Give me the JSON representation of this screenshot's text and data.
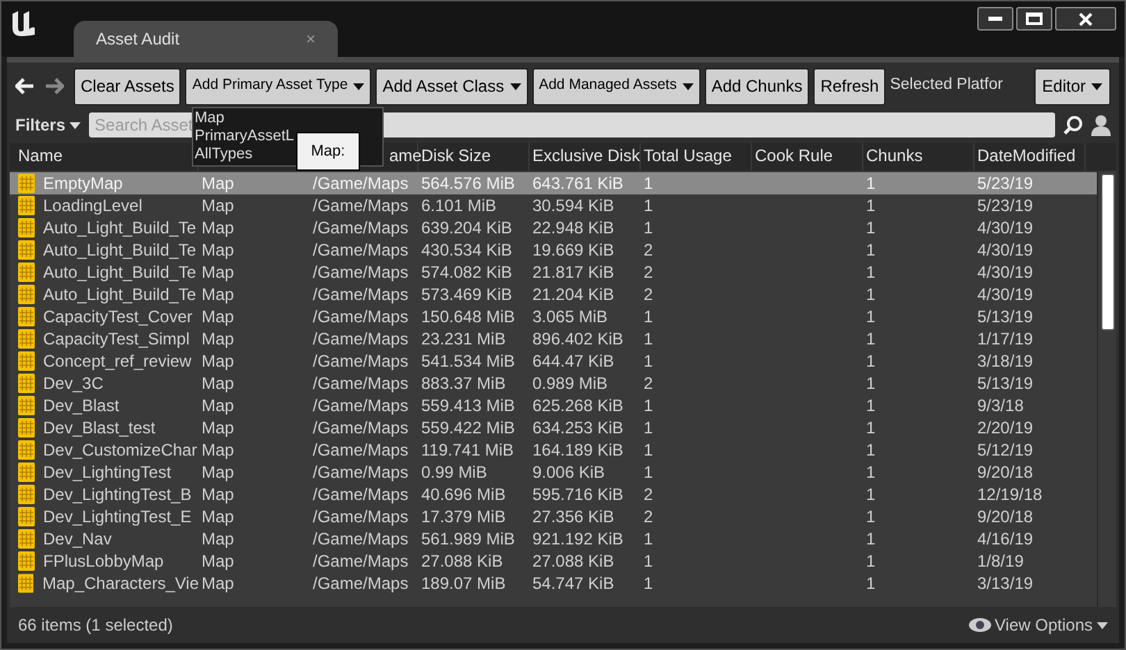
{
  "window": {
    "tab": {
      "title": "Asset Audit",
      "close": "×"
    }
  },
  "toolbar": {
    "buttons": [
      {
        "label": "Clear Assets",
        "dropdown": false,
        "small": false
      },
      {
        "label": "Add Primary Asset Type",
        "dropdown": true,
        "small": true
      },
      {
        "label": "Add Asset Class",
        "dropdown": true,
        "small": false
      },
      {
        "label": "Add Managed Assets",
        "dropdown": true,
        "small": true
      },
      {
        "label": "Add Chunks",
        "dropdown": false,
        "small": false
      },
      {
        "label": "Refresh",
        "dropdown": false,
        "small": false
      }
    ],
    "platform_label": "Selected Platfor",
    "platform": "Editor"
  },
  "dropdown_menu": {
    "items": [
      "Map",
      "PrimaryAssetL",
      "AllTypes"
    ]
  },
  "tooltip": "Map:",
  "filters": {
    "label": "Filters",
    "search_placeholder": "Search Asset"
  },
  "table": {
    "columns": [
      {
        "label": "Name"
      },
      {},
      {
        "label": "ame"
      },
      {
        "label": "Disk Size"
      },
      {
        "label": "Exclusive Disk"
      },
      {
        "label": "Total Usage"
      },
      {
        "label": "Cook Rule"
      },
      {
        "label": "Chunks"
      },
      {
        "label": "DateModified"
      }
    ],
    "rows": [
      {
        "name": "EmptyMap",
        "type": "Map",
        "path": "/Game/Maps",
        "disk_size": "564.576 MiB",
        "exclusive_disk": "643.761 KiB",
        "total_usage": "1",
        "chunks": "1",
        "date_modified": "5/23/19",
        "selected": true
      },
      {
        "name": "LoadingLevel",
        "type": "Map",
        "path": "/Game/Maps",
        "disk_size": "6.101 MiB",
        "exclusive_disk": "30.594 KiB",
        "total_usage": "1",
        "chunks": "1",
        "date_modified": "5/23/19",
        "selected": false
      },
      {
        "name": "Auto_Light_Build_Te",
        "type": "Map",
        "path": "/Game/Maps",
        "disk_size": "639.204 KiB",
        "exclusive_disk": "22.948 KiB",
        "total_usage": "1",
        "chunks": "1",
        "date_modified": "4/30/19",
        "selected": false
      },
      {
        "name": "Auto_Light_Build_Te",
        "type": "Map",
        "path": "/Game/Maps",
        "disk_size": "430.534 KiB",
        "exclusive_disk": "19.669 KiB",
        "total_usage": "2",
        "chunks": "1",
        "date_modified": "4/30/19",
        "selected": false
      },
      {
        "name": "Auto_Light_Build_Te",
        "type": "Map",
        "path": "/Game/Maps",
        "disk_size": "574.082 KiB",
        "exclusive_disk": "21.817 KiB",
        "total_usage": "2",
        "chunks": "1",
        "date_modified": "4/30/19",
        "selected": false
      },
      {
        "name": "Auto_Light_Build_Te",
        "type": "Map",
        "path": "/Game/Maps",
        "disk_size": "573.469 KiB",
        "exclusive_disk": "21.204 KiB",
        "total_usage": "2",
        "chunks": "1",
        "date_modified": "4/30/19",
        "selected": false
      },
      {
        "name": "CapacityTest_Cover",
        "type": "Map",
        "path": "/Game/Maps",
        "disk_size": "150.648 MiB",
        "exclusive_disk": "3.065 MiB",
        "total_usage": "1",
        "chunks": "1",
        "date_modified": "5/13/19",
        "selected": false
      },
      {
        "name": "CapacityTest_Simpl",
        "type": "Map",
        "path": "/Game/Maps",
        "disk_size": "23.231 MiB",
        "exclusive_disk": "896.402 KiB",
        "total_usage": "1",
        "chunks": "1",
        "date_modified": "1/17/19",
        "selected": false
      },
      {
        "name": "Concept_ref_review",
        "type": "Map",
        "path": "/Game/Maps",
        "disk_size": "541.534 MiB",
        "exclusive_disk": "644.47 KiB",
        "total_usage": "1",
        "chunks": "1",
        "date_modified": "3/18/19",
        "selected": false
      },
      {
        "name": "Dev_3C",
        "type": "Map",
        "path": "/Game/Maps",
        "disk_size": "883.37 MiB",
        "exclusive_disk": "0.989 MiB",
        "total_usage": "2",
        "chunks": "1",
        "date_modified": "5/13/19",
        "selected": false
      },
      {
        "name": "Dev_Blast",
        "type": "Map",
        "path": "/Game/Maps",
        "disk_size": "559.413 MiB",
        "exclusive_disk": "625.268 KiB",
        "total_usage": "1",
        "chunks": "1",
        "date_modified": "9/3/18",
        "selected": false
      },
      {
        "name": "Dev_Blast_test",
        "type": "Map",
        "path": "/Game/Maps",
        "disk_size": "559.422 MiB",
        "exclusive_disk": "634.253 KiB",
        "total_usage": "1",
        "chunks": "1",
        "date_modified": "2/20/19",
        "selected": false
      },
      {
        "name": "Dev_CustomizeChar",
        "type": "Map",
        "path": "/Game/Maps",
        "disk_size": "119.741 MiB",
        "exclusive_disk": "164.189 KiB",
        "total_usage": "1",
        "chunks": "1",
        "date_modified": "5/12/19",
        "selected": false
      },
      {
        "name": "Dev_LightingTest",
        "type": "Map",
        "path": "/Game/Maps",
        "disk_size": "0.99 MiB",
        "exclusive_disk": "9.006 KiB",
        "total_usage": "1",
        "chunks": "1",
        "date_modified": "9/20/18",
        "selected": false
      },
      {
        "name": "Dev_LightingTest_B",
        "type": "Map",
        "path": "/Game/Maps",
        "disk_size": "40.696 MiB",
        "exclusive_disk": "595.716 KiB",
        "total_usage": "2",
        "chunks": "1",
        "date_modified": "12/19/18",
        "selected": false
      },
      {
        "name": "Dev_LightingTest_E",
        "type": "Map",
        "path": "/Game/Maps",
        "disk_size": "17.379 MiB",
        "exclusive_disk": "27.356 KiB",
        "total_usage": "2",
        "chunks": "1",
        "date_modified": "9/20/18",
        "selected": false
      },
      {
        "name": "Dev_Nav",
        "type": "Map",
        "path": "/Game/Maps",
        "disk_size": "561.989 MiB",
        "exclusive_disk": "921.192 KiB",
        "total_usage": "1",
        "chunks": "1",
        "date_modified": "4/16/19",
        "selected": false
      },
      {
        "name": "FPlusLobbyMap",
        "type": "Map",
        "path": "/Game/Maps",
        "disk_size": "27.088 KiB",
        "exclusive_disk": "27.088 KiB",
        "total_usage": "1",
        "chunks": "1",
        "date_modified": "1/8/19",
        "selected": false
      },
      {
        "name": "Map_Characters_Vie",
        "type": "Map",
        "path": "/Game/Maps",
        "disk_size": "189.07 MiB",
        "exclusive_disk": "54.747 KiB",
        "total_usage": "1",
        "chunks": "1",
        "date_modified": "3/13/19",
        "selected": false
      }
    ]
  },
  "status_bar": {
    "count": "66 items (1 selected)",
    "view_options": "View Options"
  }
}
